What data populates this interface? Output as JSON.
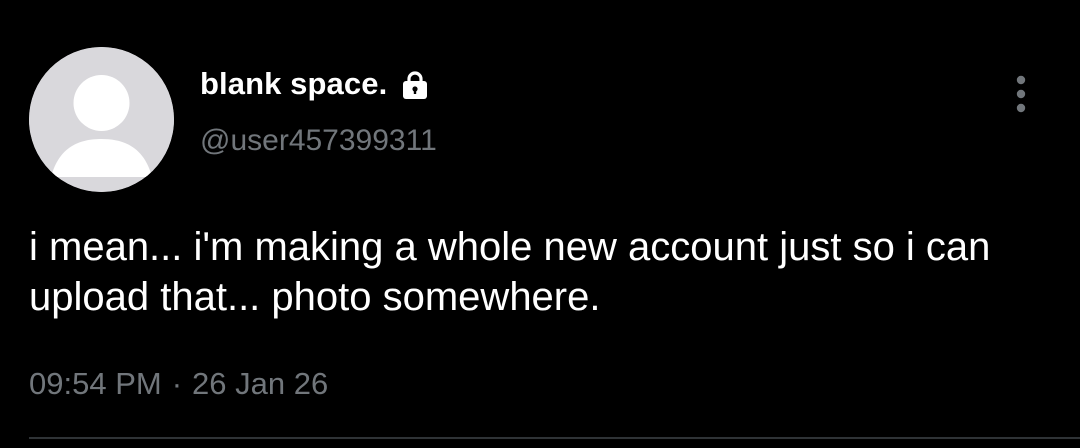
{
  "author": {
    "display_name": "blank space.",
    "handle": "@user457399311",
    "protected_icon": "lock-icon",
    "avatar_icon": "default-avatar-icon"
  },
  "tweet": {
    "text": "i mean... i'm making a whole new account just so i can upload that... photo somewhere.",
    "time": "09:54 PM",
    "separator": "·",
    "date": "26 Jan 26"
  },
  "menu": {
    "icon": "more-vertical-icon"
  },
  "colors": {
    "background": "#000000",
    "text": "#ffffff",
    "secondary_text": "#71767b",
    "avatar_bg": "#d9d8dc",
    "divider": "#2f3336"
  }
}
